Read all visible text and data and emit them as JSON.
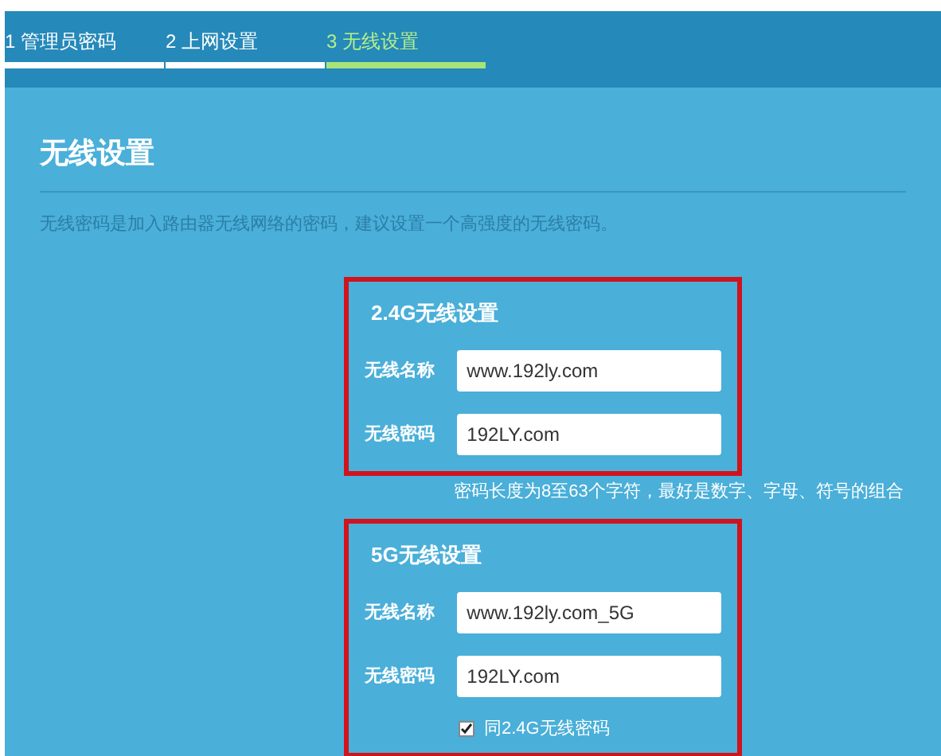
{
  "tabs": [
    {
      "label": "1 管理员密码",
      "selected": false
    },
    {
      "label": "2 上网设置",
      "selected": false
    },
    {
      "label": "3 无线设置",
      "selected": true
    }
  ],
  "title": "无线设置",
  "description": "无线密码是加入路由器无线网络的密码，建议设置一个高强度的无线密码。",
  "bands": [
    {
      "heading": "2.4G无线设置",
      "highlighted": true,
      "fields": [
        {
          "label": "无线名称",
          "value": "www.192ly.com"
        },
        {
          "label": "无线密码",
          "value": "192LY.com"
        }
      ],
      "hint": "密码长度为8至63个字符，最好是数字、字母、符号的组合"
    },
    {
      "heading": "5G无线设置",
      "highlighted": true,
      "fields": [
        {
          "label": "无线名称",
          "value": "www.192ly.com_5G"
        },
        {
          "label": "无线密码",
          "value": "192LY.com"
        }
      ],
      "checkbox": {
        "label": "同2.4G无线密码",
        "checked": true
      }
    }
  ]
}
